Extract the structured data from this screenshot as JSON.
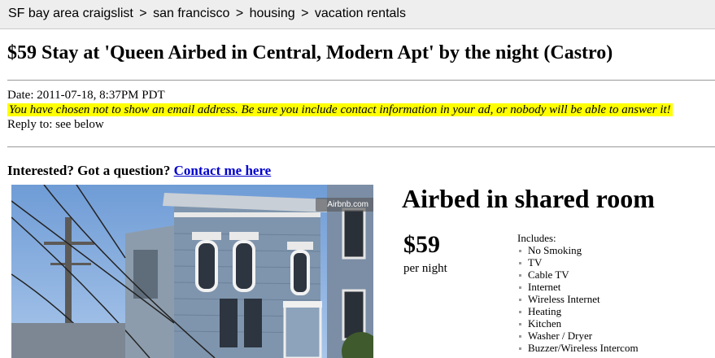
{
  "breadcrumb": {
    "items": [
      "SF bay area craigslist",
      "san francisco",
      "housing",
      "vacation rentals"
    ],
    "separator": ">"
  },
  "post": {
    "title": "$59 Stay at 'Queen Airbed in Central, Modern Apt' by the night (Castro)",
    "date": "Date: 2011-07-18, 8:37PM PDT",
    "email_warning": "You have chosen not to show an email address. Be sure you include contact information in your ad, or nobody will be able to answer it!",
    "reply_to": "Reply to: see below",
    "question_text": "Interested? Got a question?",
    "contact_link": "Contact me here"
  },
  "photo": {
    "badge": "Airbnb.com"
  },
  "listing": {
    "heading": "Airbed in shared room",
    "price": "$59",
    "price_unit": "per night",
    "includes_label": "Includes:",
    "amenities": [
      "No Smoking",
      "TV",
      "Cable TV",
      "Internet",
      "Wireless Internet",
      "Heating",
      "Kitchen",
      "Washer / Dryer",
      "Buzzer/Wireless Intercom"
    ]
  },
  "colors": {
    "highlight": "#ffff00",
    "link": "#0000cc",
    "crumb_bg": "#eeeeee"
  }
}
